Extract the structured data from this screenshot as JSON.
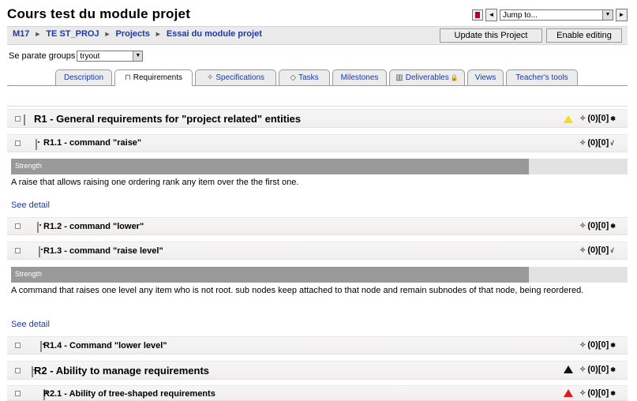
{
  "header": {
    "title": "Cours test du module projet"
  },
  "navigation": {
    "jump_label": "Jump to...",
    "prev_arrow": "◄",
    "next_arrow": "►",
    "dropdown_glyph": "▼",
    "report_icon": "report-icon"
  },
  "breadcrumb": {
    "items": [
      "M17",
      "TE ST_PROJ",
      "Projects",
      "Essai du module projet"
    ],
    "separator": "►"
  },
  "buttons": {
    "update": "Update this Project",
    "edit": "Enable editing"
  },
  "groups": {
    "label": "Se parate groups",
    "value": "tryout",
    "dropdown_glyph": "▼"
  },
  "tabs": [
    {
      "label": "Description",
      "icon": ""
    },
    {
      "label": "Requirements",
      "icon": "⊓"
    },
    {
      "label": "Specifications",
      "icon": "✧"
    },
    {
      "label": "Tasks",
      "icon": "◇"
    },
    {
      "label": "Milestones",
      "icon": ""
    },
    {
      "label": "Deliverables",
      "icon": "▥",
      "suffix": "🔒"
    },
    {
      "label": "Views",
      "icon": ""
    },
    {
      "label": "Teacher's tools",
      "icon": ""
    }
  ],
  "requirements": [
    {
      "id": "r1",
      "text": "R1 - General requirements for \"project related\" entities",
      "level": 1,
      "marker": "yellow",
      "counts": "(0)[0]",
      "action": "✱"
    },
    {
      "id": "r1_1",
      "text": "R1.1 - command \"raise\"",
      "level": 2,
      "marker": "",
      "counts": "(0)[0]",
      "action": "√"
    },
    {
      "id": "r1_2",
      "text": "R1.2 - command \"lower\"",
      "level": 2,
      "marker": "",
      "counts": "(0)[0]",
      "action": "✱"
    },
    {
      "id": "r1_3",
      "text": "R1.3 - command \"raise level\"",
      "level": 2,
      "marker": "",
      "counts": "(0)[0]",
      "action": "√"
    },
    {
      "id": "r1_4",
      "text": "R1.4 - Command \"lower level\"",
      "level": 2,
      "marker": "",
      "counts": "(0)[0]",
      "action": "✱"
    },
    {
      "id": "r2",
      "text": "R2 - Ability to manage requirements",
      "level": 1,
      "marker": "black",
      "counts": "(0)[0]",
      "action": "✱"
    },
    {
      "id": "r2_1",
      "text": "R2.1 - Ability of tree-shaped requirements",
      "level": 2,
      "marker": "red",
      "counts": "(0)[0]",
      "action": "✱"
    }
  ],
  "details": {
    "r1_1": {
      "strength_label": "Strength",
      "strength_fraction": 0.84,
      "description": "A raise that allows raising one ordering rank any item over the the first one.",
      "link": "See detail"
    },
    "r1_3": {
      "strength_label": "Strength",
      "strength_fraction": 0.84,
      "description": "A command that raises one level any item who is not root. sub nodes keep attached to that node and remain subnodes of that node, being reordered.",
      "link": "See detail"
    }
  },
  "colors": {
    "link": "#1a3aa6",
    "strength_fill": "#999999",
    "strength_track": "#e2e2e2",
    "marker_yellow": "#f2de1c",
    "marker_red": "#e31a1a",
    "marker_black": "#111111"
  }
}
